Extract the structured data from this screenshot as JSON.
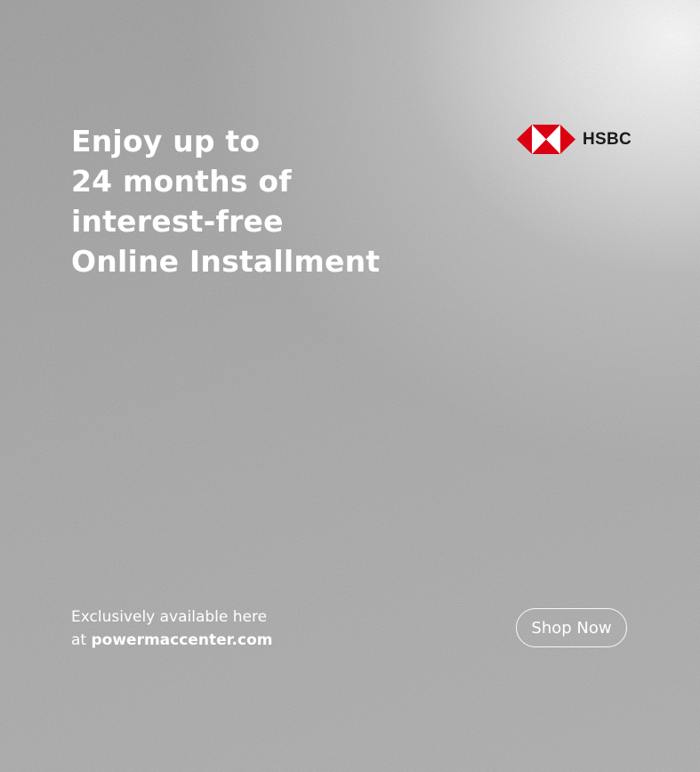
{
  "banner": {
    "headline_lines": [
      "Enjoy up to",
      "24 months of",
      "interest-free",
      "Online Installment"
    ],
    "logo": {
      "text": "HSBC",
      "icon": "hsbc-hexagon-icon",
      "colors": {
        "red": "#db0011",
        "white": "#ffffff"
      }
    },
    "subtext": {
      "line1": "Exclusively available here",
      "line2_prefix": "at ",
      "site": "powermaccenter.com"
    },
    "cta_label": "Shop Now"
  },
  "colors": {
    "background": "#a4a4a4",
    "highlight": "#f5f5f5",
    "text": "#ffffff"
  }
}
